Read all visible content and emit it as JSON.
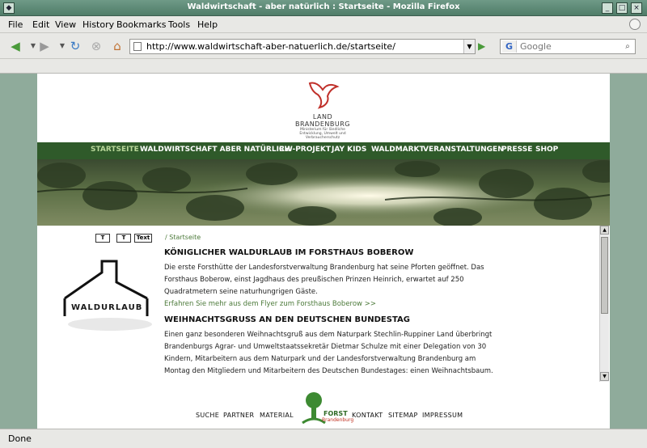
{
  "window": {
    "title": "Waldwirtschaft - aber natürlich : Startseite - Mozilla Firefox"
  },
  "menu": [
    "File",
    "Edit",
    "View",
    "History",
    "Bookmarks",
    "Tools",
    "Help"
  ],
  "toolbar": {
    "url": "http://www.waldwirtschaft-aber-natuerlich.de/startseite/",
    "search_placeholder": "Google",
    "search_engine_glyph": "G"
  },
  "site": {
    "logo": {
      "line1": "LAND",
      "line2": "BRANDENBURG",
      "line3": "Ministerium für ländliche Entwicklung, Umwelt und Verbraucherschutz"
    },
    "nav": [
      "STARTSEITE",
      "WALDWIRTSCHAFT ABER NATÜRLICH",
      "RW-PROJEKT",
      "JAY KIDS",
      "WALDMARKT",
      "VERANSTALTUNGEN",
      "PRESSE",
      "SHOP"
    ],
    "text_buttons": [
      "T",
      "T",
      "Text"
    ],
    "breadcrumb": "/ Startseite",
    "left_logo_text": "WALDURLAUB",
    "articles": [
      {
        "title": "KÖNIGLICHER WALDURLAUB IM FORSTHAUS BOBEROW",
        "lines": [
          "Die erste Forsthütte der Landesforstverwaltung Brandenburg hat seine Pforten geöffnet. Das",
          "Forsthaus Boberow, einst Jagdhaus des preußischen Prinzen Heinrich, erwartet auf 250",
          "Quadratmetern seine naturhungrigen Gäste."
        ],
        "link": "Erfahren Sie mehr aus dem Flyer zum Forsthaus Boberow >>"
      },
      {
        "title": "WEIHNACHTSGRUSS AN DEN DEUTSCHEN BUNDESTAG",
        "lines": [
          "Einen ganz besonderen Weihnachtsgruß aus dem Naturpark Stechlin-Ruppiner Land überbringt",
          "Brandenburgs Agrar- und Umweltstaatssekretär Dietmar Schulze mit einer Delegation von 30",
          "Kindern, Mitarbeitern aus dem Naturpark und der Landesforstverwaltung Brandenburg am",
          "Montag den Mitgliedern und Mitarbeitern des Deutschen Bundestages: einen Weihnachtsbaum."
        ]
      }
    ],
    "footer_left": [
      "SUCHE",
      "PARTNER",
      "MATERIAL"
    ],
    "footer_right": [
      "KONTAKT",
      "SITEMAP",
      "IMPRESSUM"
    ],
    "forst_logo": {
      "name": "FORST",
      "region": "Brandenburg"
    }
  },
  "status": {
    "text": "Done"
  },
  "colors": {
    "nav_bg": "#2f5a2a",
    "nav_active": "#b9d89a",
    "link_green": "#4c7a3a",
    "accent_red": "#c03020"
  }
}
